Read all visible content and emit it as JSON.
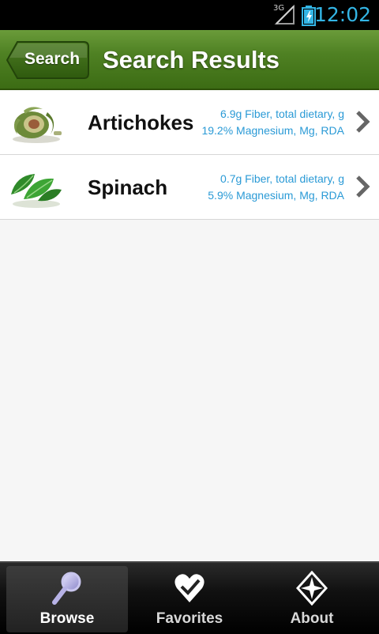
{
  "status_bar": {
    "network": "3G",
    "time": "12:02"
  },
  "header": {
    "back_label": "Search",
    "title": "Search Results"
  },
  "results": [
    {
      "name": "Artichokes",
      "line1": "6.9g Fiber, total dietary, g",
      "line2": "19.2% Magnesium, Mg, RDA",
      "icon": "artichoke-icon"
    },
    {
      "name": "Spinach",
      "line1": "0.7g Fiber, total dietary, g",
      "line2": "5.9% Magnesium, Mg, RDA",
      "icon": "spinach-icon"
    }
  ],
  "tabs": [
    {
      "label": "Browse",
      "icon": "magnifier-icon",
      "active": true
    },
    {
      "label": "Favorites",
      "icon": "heart-check-icon",
      "active": false
    },
    {
      "label": "About",
      "icon": "compass-star-icon",
      "active": false
    }
  ],
  "colors": {
    "header_green": "#4f8123",
    "accent_blue": "#33b5e5",
    "nutrient_blue": "#2a9ad6"
  }
}
